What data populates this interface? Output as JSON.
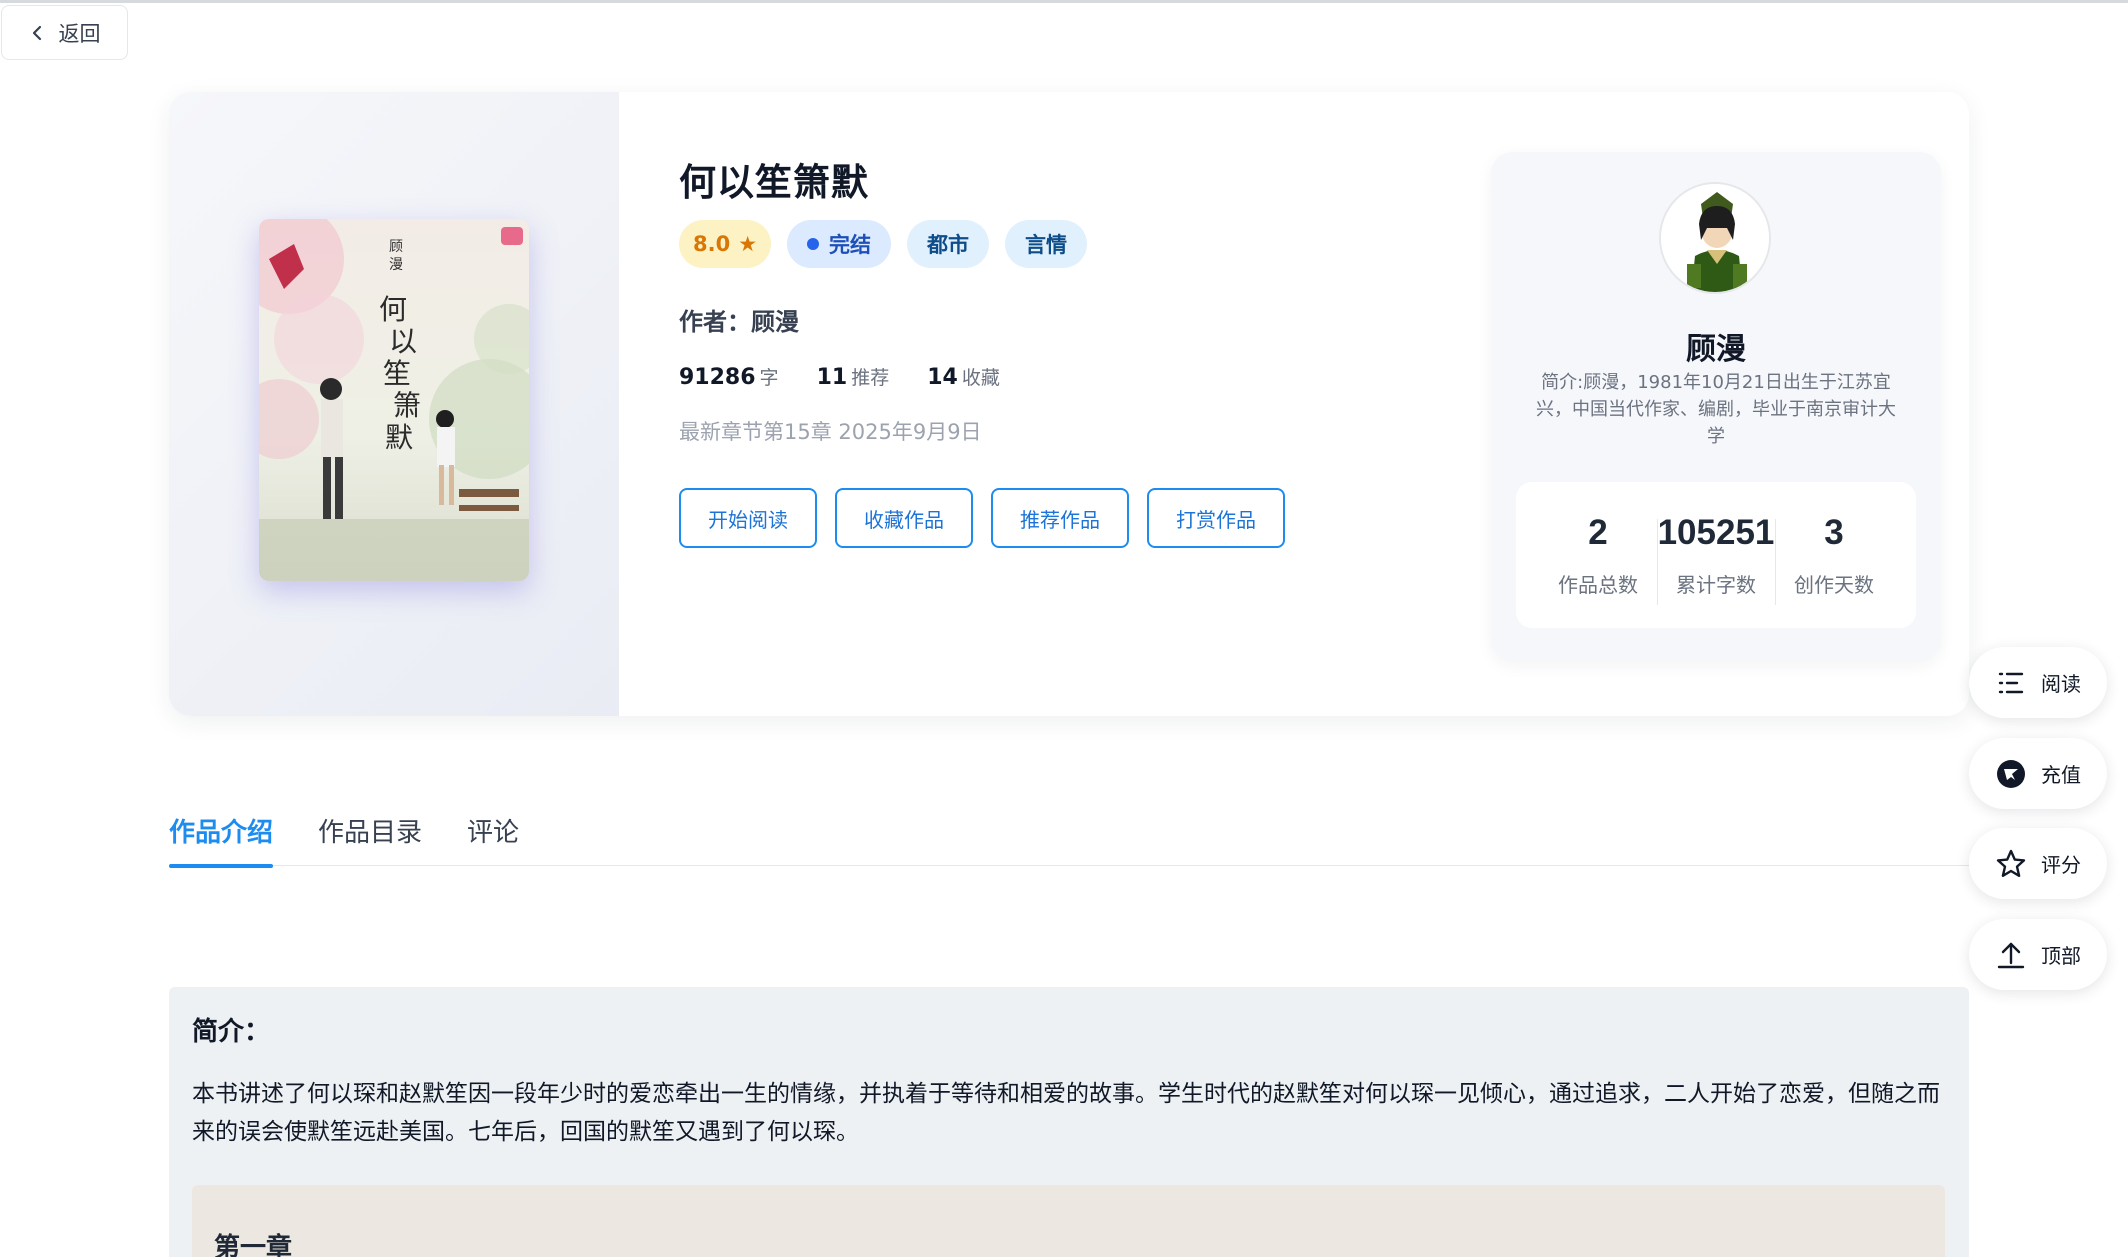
{
  "nav": {
    "back_label": "返回"
  },
  "book": {
    "title": "何以笙箫默",
    "rating": "8.0",
    "status": "完结",
    "genres": [
      "都市",
      "言情"
    ],
    "author_label": "作者：",
    "author": "顾漫",
    "word_count": "91286",
    "word_unit": "字",
    "recommend_count": "11",
    "recommend_unit": "推荐",
    "favorite_count": "14",
    "favorite_unit": "收藏",
    "latest_chapter": "最新章节第15章 2025年9月9日",
    "actions": [
      "开始阅读",
      "收藏作品",
      "推荐作品",
      "打赏作品"
    ]
  },
  "author_card": {
    "name": "顾漫",
    "intro": "简介:顾漫，1981年10月21日出生于江苏宜兴，中国当代作家、编剧，毕业于南京审计大学",
    "stats": [
      {
        "value": "2",
        "label": "作品总数"
      },
      {
        "value": "105251",
        "label": "累计字数"
      },
      {
        "value": "3",
        "label": "创作天数"
      }
    ]
  },
  "tabs": [
    "作品介绍",
    "作品目录",
    "评论"
  ],
  "intro": {
    "label": "简介：",
    "text": "本书讲述了何以琛和赵默笙因一段年少时的爱恋牵出一生的情缘，并执着于等待和相爱的故事。学生时代的赵默笙对何以琛一见倾心，通过追求，二人开始了恋爱，但随之而来的误会使默笙远赴美国。七年后，回国的默笙又遇到了何以琛。",
    "chapter_title": "第一章"
  },
  "float_actions": [
    {
      "label": "阅读",
      "icon": "list-icon"
    },
    {
      "label": "充值",
      "icon": "recharge-icon"
    },
    {
      "label": "评分",
      "icon": "star-icon"
    },
    {
      "label": "顶部",
      "icon": "arrow-up-icon"
    }
  ],
  "colors": {
    "accent": "#1d8cf0",
    "rating": "#d97706",
    "status": "#2563eb"
  }
}
